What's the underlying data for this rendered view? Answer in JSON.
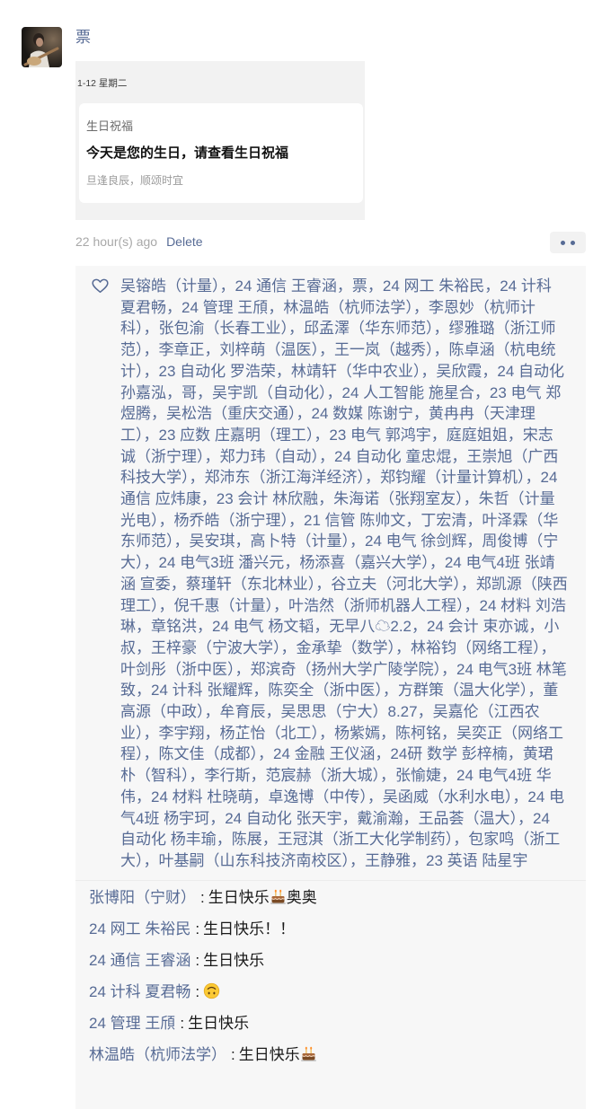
{
  "post": {
    "author": {
      "name": "票",
      "avatar_icon": "avatar-photo"
    },
    "attachment": {
      "date_label": "1-12 星期二",
      "card_title": "生日祝福",
      "card_headline": "今天是您的生日，请查看生日祝福",
      "card_subtext": "旦逢良辰，顺颂时宜"
    },
    "timestamp": "22 hour(s) ago",
    "delete_label": "Delete",
    "more_icon": "more-dots-icon"
  },
  "likes": {
    "icon": "heart-outline-icon",
    "separator": "，",
    "names": [
      "吴镕皓（计量）",
      "24 通信 王睿涵",
      "票",
      "24 网工 朱裕民",
      "24 计科 夏君畅",
      "24 管理 王頎",
      "林温皓（杭师法学）",
      "李恩妙（杭师计科）",
      "张包渝（长春工业）",
      "邱孟澤（华东师范）",
      "缪雅璐（浙江师范）",
      "李章正",
      "刘梓萌（温医）",
      "王一岚（越秀）",
      "陈卓涵（杭电统计）",
      "23 自动化 罗浩荣",
      "林靖轩（华中农业）",
      "吴欣霞",
      "24 自动化 孙嘉泓",
      "哥",
      "吴宇凯（自动化）",
      "24 人工智能 施星合",
      "23 电气 郑煜腾",
      "吴松浩（重庆交通）",
      "24 数媒 陈谢宁",
      "黄冉冉（天津理工）",
      "23 应数 庄嘉明（理工）",
      "23 电气 郭鸿宇",
      "庭庭姐姐",
      "宋志诚（浙宁理）",
      "郑力玮（自动）",
      "24 自动化 童忠焜",
      "王崇旭（广西科技大学）",
      "郑沛东（浙江海洋经济）",
      "郑钧耀（计量计算机）",
      "24 通信 应炜康",
      "23 会计 林欣融",
      "朱海诺（张翔室友）",
      "朱哲（计量光电）",
      "杨乔皓（浙宁理）",
      "21 信管 陈帅文",
      "丁宏清",
      "叶泽霖（华东师范）",
      "吴安琪",
      "高卜特（计量）",
      "24 电气 徐剑辉",
      "周俊博（宁大）",
      "24 电气3班 潘兴元",
      "杨添喜（嘉兴大学）",
      "24 电气4班 张靖涵 宣委",
      "蔡瑾轩（东北林业）",
      "谷立夫（河北大学）",
      "郑凯源（陕西理工）",
      "倪千惠（计量）",
      "叶浩然（浙师机器人工程）",
      "24 材料 刘浩琳",
      "章铭洪",
      "24 电气 杨文韬",
      "无早八☁2.2",
      "24 会计 束亦诚",
      "小叔",
      "王梓豪（宁波大学）",
      "金承挚（数学）",
      "林裕钧（网络工程）",
      "叶剑彤（浙中医）",
      "郑滨奇（扬州大学广陵学院）",
      "24 电气3班 林笔致",
      "24 计科 张耀辉",
      "陈奕全（浙中医）",
      "方群策（温大化学）",
      "董高源（中政）",
      "牟育辰",
      "吴思思（宁大）8.27",
      "吴嘉伦（江西农业）",
      "李宇翔",
      "杨芷怡（北工）",
      "杨紫嫣",
      "陈柯铭",
      "吴奕正（网络工程）",
      "陈文佳（成都）",
      "24 金融 王仪涵",
      "24研 数学 彭梓楠",
      "黄珺朴（智科）",
      "李行斯",
      "范宸赫（浙大城）",
      "张愉婕",
      "24 电气4班 华伟",
      "24 材料 杜晓萌",
      "卓逸博（中传）",
      "吴函威（水利水电）",
      "24 电气4班 杨宇珂",
      "24 自动化 张天宇",
      "戴渝瀚",
      "王品荟（温大）",
      "24 自动化 杨丰瑜",
      "陈展",
      "王冠淇（浙工大化学制药）",
      "包家鸣（浙工大）",
      "叶基嗣（山东科技济南校区）",
      "王静雅",
      "23 英语 陆星宇"
    ]
  },
  "comments": {
    "separator": ":",
    "items": [
      {
        "name": "张博阳（宁财）",
        "content": [
          {
            "text": "生日快乐"
          },
          {
            "icon": "cake-emoji"
          },
          {
            "text": "奥奥"
          }
        ]
      },
      {
        "name": "24 网工 朱裕民",
        "content": [
          {
            "text": "生日快乐！！"
          }
        ]
      },
      {
        "name": "24 通信 王睿涵",
        "content": [
          {
            "text": "生日快乐"
          }
        ]
      },
      {
        "name": "24 计科 夏君畅",
        "content": [
          {
            "icon": "upside-down-face-emoji"
          }
        ]
      },
      {
        "name": "24 管理 王頎",
        "content": [
          {
            "text": "生日快乐"
          }
        ]
      },
      {
        "name": "林温皓（杭师法学）",
        "content": [
          {
            "text": "生日快乐"
          },
          {
            "icon": "cake-emoji"
          }
        ]
      }
    ]
  },
  "colors": {
    "link": "#576b95",
    "text": "#191919",
    "muted": "#a8a8a8",
    "panel": "#f7f7f7"
  }
}
